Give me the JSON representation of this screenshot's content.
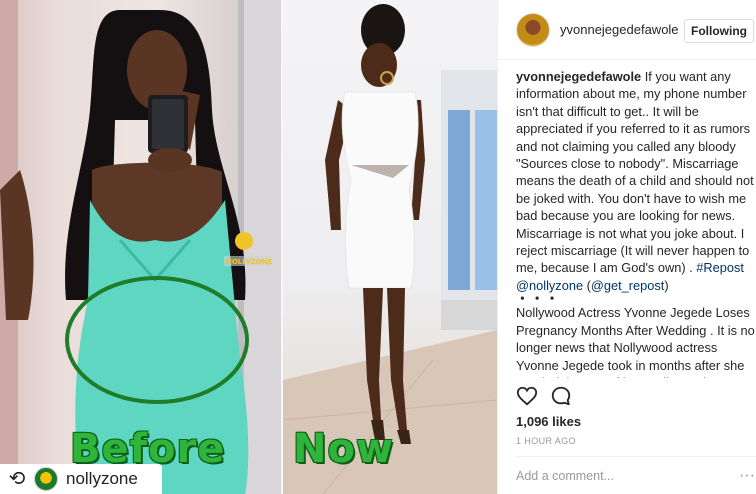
{
  "photo": {
    "before_label": "Before",
    "now_label": "Now",
    "watermark": "NOLLYZONE",
    "repost": {
      "icon": "repost-icon",
      "username": "nollyzone"
    }
  },
  "post": {
    "username": "yvonnejegedefawole",
    "follow_label": "Following",
    "caption_user": "yvonnejegedefawole",
    "caption_text": " If you want any information about me, my phone number isn't that difficult to get.. It will be appreciated if you referred to it as rumors and not claiming you called any bloody \"Sources close to nobody\". Miscarriage means the death of a child and should not be joked with. You don't have to wish me bad because you are looking for news. Miscarriage is not what you joke about. I reject miscarriage (It will never happen to me, because I am God's own) . ",
    "hashtag": "#Repost",
    "mention_1": "@nollyzone",
    "mention_2_open": "(",
    "mention_2": "@get_repost",
    "mention_2_close": ")",
    "dots": "・・・",
    "body_text": "Nollywood Actress Yvonne Jegede Loses Pregnancy Months After Wedding . It is no longer news that Nollywood actress Yvonne Jegede took in months after she married the son of late Nollywood actress Bukky Ajayi but it",
    "likes": "1,096 likes",
    "time": "1 HOUR AGO",
    "comment_placeholder": "Add a comment..."
  },
  "icons": [
    "heart-icon",
    "comment-icon",
    "more-options-icon"
  ],
  "colors": {
    "link": "#003569",
    "caption_green": "#2fb53c",
    "border": "#efefef"
  }
}
